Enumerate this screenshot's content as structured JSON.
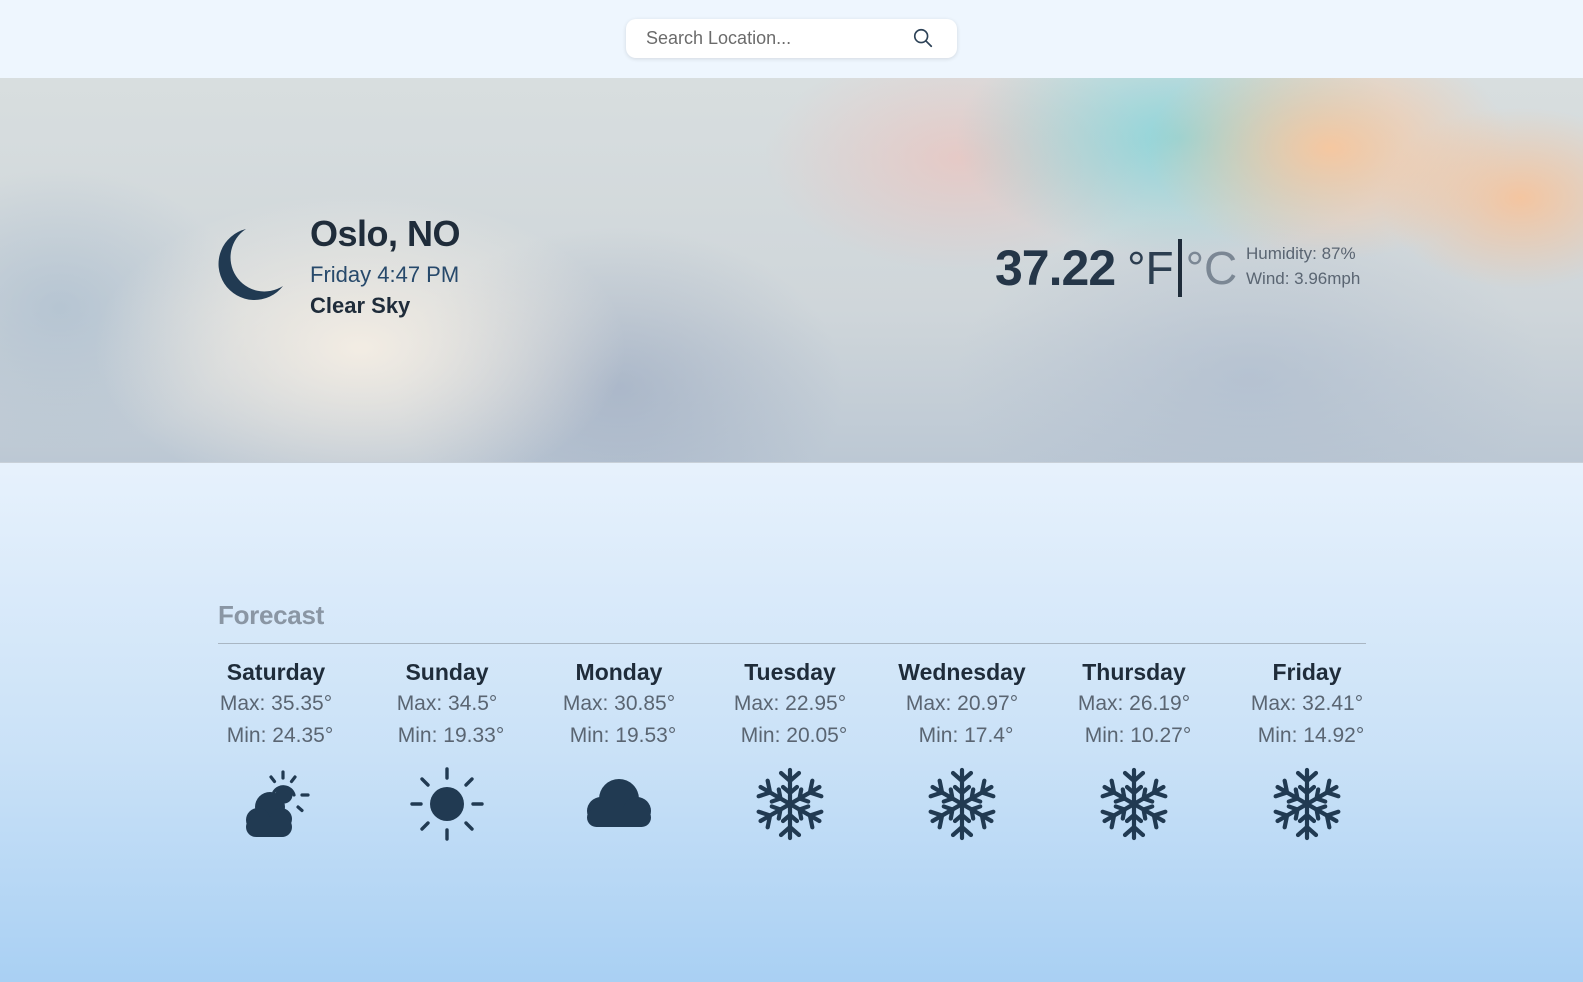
{
  "search": {
    "placeholder": "Search Location...",
    "value": ""
  },
  "current": {
    "location": "Oslo, NO",
    "datetime": "Friday 4:47 PM",
    "condition": "Clear Sky",
    "icon": "moon-icon",
    "temperature": "37.22",
    "unit_f": "°F",
    "unit_c": "°C",
    "humidity": "Humidity: 87%",
    "wind": "Wind: 3.96mph"
  },
  "forecast": {
    "title": "Forecast",
    "days": [
      {
        "name": "Saturday",
        "max": "Max: 35.35°",
        "min": "Min: 24.35°",
        "icon": "partly-cloudy-icon"
      },
      {
        "name": "Sunday",
        "max": "Max: 34.5°",
        "min": "Min: 19.33°",
        "icon": "sun-icon"
      },
      {
        "name": "Monday",
        "max": "Max: 30.85°",
        "min": "Min: 19.53°",
        "icon": "cloud-icon"
      },
      {
        "name": "Tuesday",
        "max": "Max: 22.95°",
        "min": "Min: 20.05°",
        "icon": "snowflake-icon"
      },
      {
        "name": "Wednesday",
        "max": "Max: 20.97°",
        "min": "Min: 17.4°",
        "icon": "snowflake-icon"
      },
      {
        "name": "Thursday",
        "max": "Max: 26.19°",
        "min": "Min: 10.27°",
        "icon": "snowflake-icon"
      },
      {
        "name": "Friday",
        "max": "Max: 32.41°",
        "min": "Min: 14.92°",
        "icon": "snowflake-icon"
      }
    ]
  },
  "colors": {
    "icon": "#213a52",
    "background_top": "#eef6fe",
    "background_bottom": "#a9d0f3"
  }
}
